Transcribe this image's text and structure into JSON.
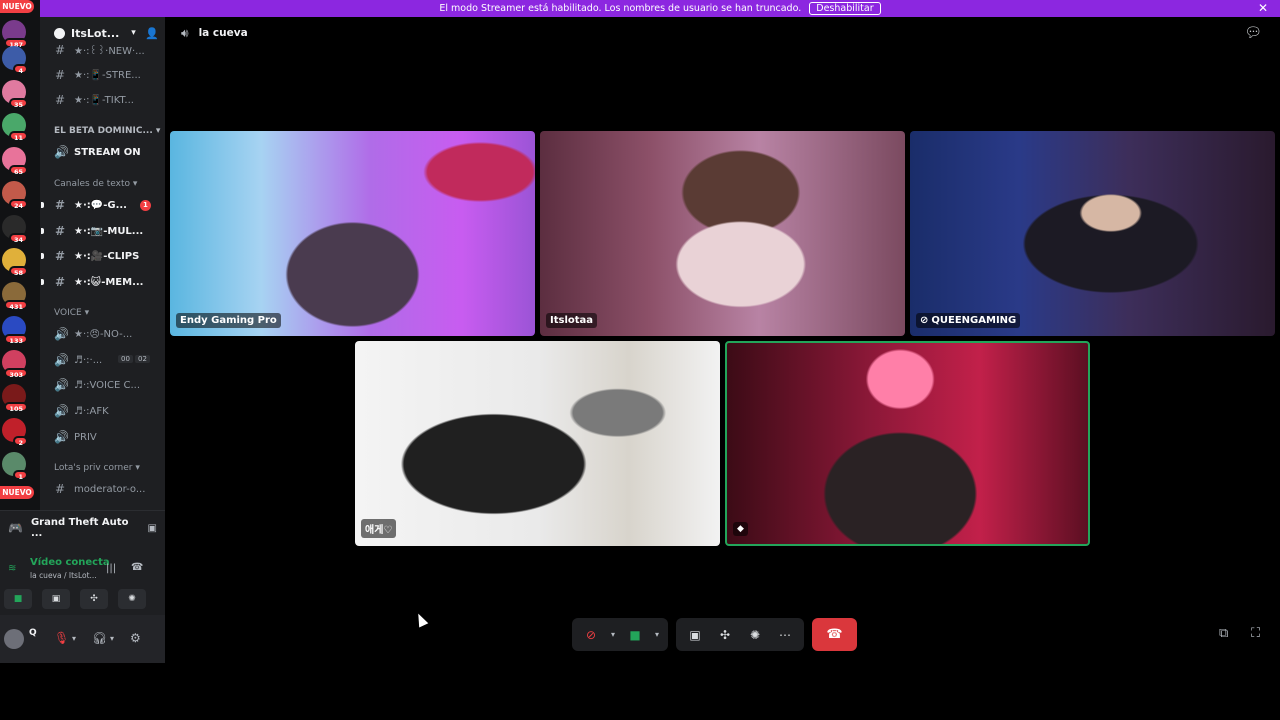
{
  "banner": {
    "text": "El modo Streamer está habilitado. Los nombres de usuario se han truncado.",
    "button": "Deshabilitar",
    "close_icon": "close-icon"
  },
  "rail": {
    "nuevo_top": "NUEVO",
    "nuevo_bottom": "NUEVO",
    "servers": [
      {
        "badge": "187",
        "color": "#7a3b8c"
      },
      {
        "badge": "4",
        "color": "#3d5ca8"
      },
      {
        "badge": "35",
        "color": "#e07aa0"
      },
      {
        "badge": "11",
        "color": "#4aa86a"
      },
      {
        "badge": "65",
        "color": "#e8739a"
      },
      {
        "badge": "24",
        "color": "#c25a4a"
      },
      {
        "badge": "34",
        "color": "#2a2a2a"
      },
      {
        "badge": "58",
        "color": "#e0b03a"
      },
      {
        "badge": "431",
        "color": "#8a6a3a"
      },
      {
        "badge": "133",
        "color": "#2a4ac2"
      },
      {
        "badge": "303",
        "color": "#d04060"
      },
      {
        "badge": "105",
        "color": "#7a1a1a"
      },
      {
        "badge": "2",
        "color": "#c0202a"
      },
      {
        "badge": "1",
        "color": "#5a8a6a"
      }
    ]
  },
  "sidebar": {
    "server_name": "ItsLot...",
    "channels": [
      {
        "icon": "#",
        "name": "★·:꒰꒱·NEW·..."
      },
      {
        "icon": "#",
        "name": "★·:📱-STRE..."
      },
      {
        "icon": "#",
        "name": "★·:📱-TIKT..."
      },
      {
        "icon": "🔊",
        "name": "STREAM ON"
      },
      {
        "icon": "#",
        "name": "★·:💬-G...",
        "unread": "1"
      },
      {
        "icon": "#",
        "name": "★·:📷-MUL..."
      },
      {
        "icon": "#",
        "name": "★·:🎥-CLIPS"
      },
      {
        "icon": "#",
        "name": "★·:😺-MEM..."
      },
      {
        "icon": "🔊",
        "name": "★·:😠-NO-..."
      },
      {
        "icon": "🔊",
        "name": "♬·:·..."
      },
      {
        "icon": "🔊",
        "name": "♬·:VOICE C..."
      },
      {
        "icon": "🔊",
        "name": "♬·:AFK"
      },
      {
        "icon": "🔊",
        "name": "PRIV"
      },
      {
        "icon": "#",
        "name": "moderator-o..."
      }
    ],
    "voice_counts": [
      "00",
      "02"
    ],
    "categories": {
      "beta": "EL BETA DOMINIC...",
      "text": "Canales de texto",
      "voice": "VOICE",
      "corner": "Lota's priv corner"
    }
  },
  "activity": {
    "game": "Grand Theft Auto ..."
  },
  "voice_panel": {
    "status": "Vídeo conecta",
    "location": "la cueva / ItsLot..."
  },
  "user_panel": {
    "name": "Q"
  },
  "main": {
    "channel_name": "la cueva"
  },
  "tiles": [
    {
      "name": "Endy Gaming Pro"
    },
    {
      "name": "Itslotaa"
    },
    {
      "name": "QUEENGAMING",
      "muted": true
    },
    {
      "name": "애게♡"
    },
    {
      "name": ""
    }
  ],
  "colors": {
    "banner": "#8c27e0",
    "accent_green": "#23a55a",
    "danger": "#da373c"
  }
}
